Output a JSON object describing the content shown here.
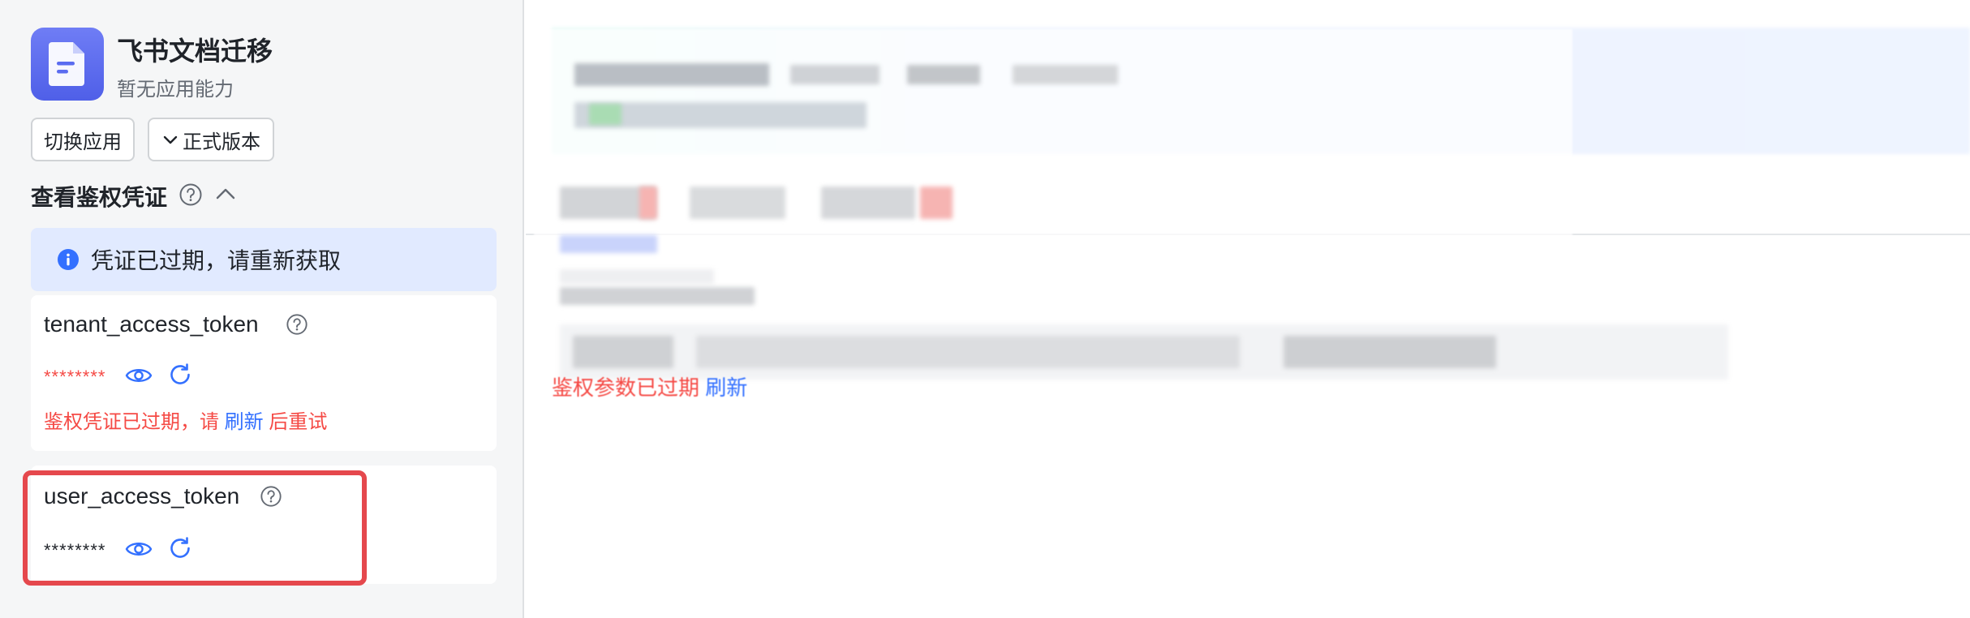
{
  "app": {
    "name": "飞书文档迁移",
    "subtitle": "暂无应用能力",
    "icon": "document-icon",
    "accent_color": "#5b6cf0"
  },
  "buttons": {
    "switch_app": "切换应用",
    "version": "正式版本"
  },
  "auth_section": {
    "title": "查看鉴权凭证",
    "alert_text": "凭证已过期，请重新获取"
  },
  "tenant_token": {
    "name": "tenant_access_token",
    "masked_value": "********",
    "error_prefix": "鉴权凭证已过期，请",
    "error_link": "刷新",
    "error_suffix": "后重试"
  },
  "user_token": {
    "name": "user_access_token",
    "masked_value": "********"
  },
  "right_panel": {
    "bottom_error_text": "鉴权参数已过期",
    "bottom_error_link": "刷新"
  },
  "colors": {
    "error": "#f54a45",
    "link": "#3370ff",
    "alert_bg": "#e1eaff",
    "highlight_border": "#e5484d"
  }
}
